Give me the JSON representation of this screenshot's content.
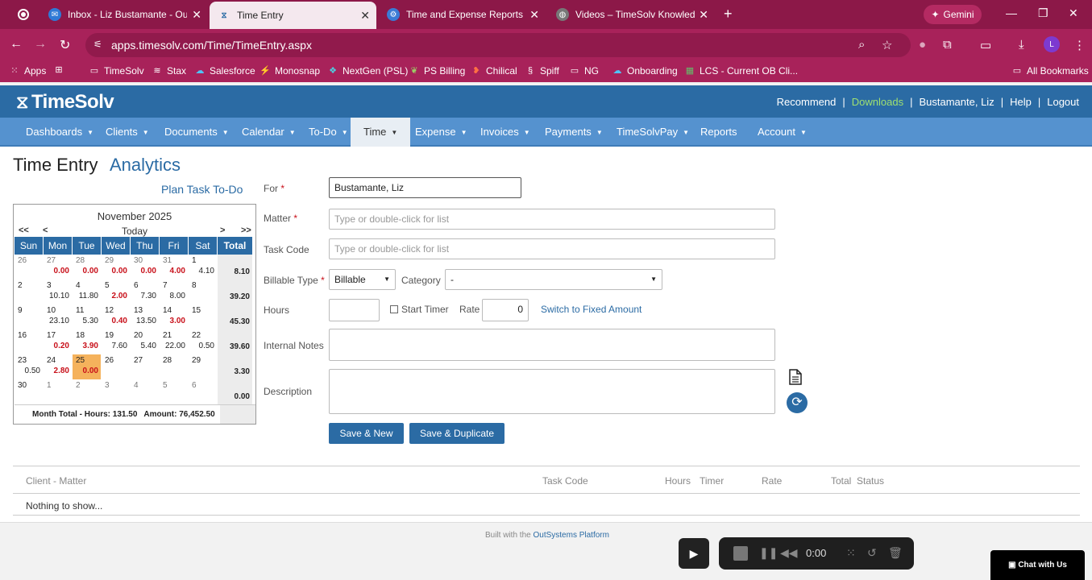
{
  "browser": {
    "tabs": [
      {
        "title": "Inbox - Liz Bustamante - Outlo"
      },
      {
        "title": "Time Entry"
      },
      {
        "title": "Time and Expense Reports"
      },
      {
        "title": "Videos – TimeSolv Knowledge B"
      }
    ],
    "gemini_label": "Gemini",
    "url": "apps.timesolv.com/Time/TimeEntry.aspx",
    "profile_initial": "L",
    "bookmarks": [
      "Apps",
      "TimeSolv",
      "Stax",
      "Salesforce",
      "Monosnap",
      "NextGen (PSL)",
      "PS Billing",
      "Chilical",
      "Spiff",
      "NG",
      "Onboarding",
      "LCS - Current OB Cli..."
    ],
    "all_bookmarks": "All Bookmarks"
  },
  "app": {
    "logo": "TimeSolv",
    "top_links": {
      "recommend": "Recommend",
      "downloads": "Downloads",
      "user": "Bustamante, Liz",
      "help": "Help",
      "logout": "Logout"
    },
    "nav": [
      "Dashboards",
      "Clients",
      "Documents",
      "Calendar",
      "To-Do",
      "Time",
      "Expense",
      "Invoices",
      "Payments",
      "TimeSolvPay",
      "Reports",
      "Account"
    ],
    "active_nav": "Time",
    "colors": {
      "header": "#2b6ba4",
      "nav": "#5592cf",
      "accent": "#2b6ba4",
      "today": "#f5b25c",
      "negative": "#c8101a"
    }
  },
  "page": {
    "title": "Time Entry",
    "analytics_tab": "Analytics",
    "plan_todo": "Plan Task To-Do"
  },
  "calendar": {
    "month": "November 2025",
    "nav_prev_year": "<<",
    "nav_prev": "<",
    "today": "Today",
    "nav_next": ">",
    "nav_next_year": ">>",
    "headers": [
      "Sun",
      "Mon",
      "Tue",
      "Wed",
      "Thu",
      "Fri",
      "Sat",
      "Total"
    ],
    "weeks": [
      {
        "days": [
          [
            "26",
            "",
            ""
          ],
          [
            "27",
            "0.00",
            "r"
          ],
          [
            "28",
            "0.00",
            "r"
          ],
          [
            "29",
            "0.00",
            "r"
          ],
          [
            "30",
            "0.00",
            "r"
          ],
          [
            "31",
            "4.00",
            "r"
          ],
          [
            "1",
            "4.10",
            "b"
          ]
        ],
        "total": "8.10"
      },
      {
        "days": [
          [
            "2",
            "",
            ""
          ],
          [
            "3",
            "10.10",
            "b"
          ],
          [
            "4",
            "11.80",
            "b"
          ],
          [
            "5",
            "2.00",
            "r"
          ],
          [
            "6",
            "7.30",
            "b"
          ],
          [
            "7",
            "8.00",
            "b"
          ],
          [
            "8",
            "",
            ""
          ]
        ],
        "total": "39.20"
      },
      {
        "days": [
          [
            "9",
            "",
            ""
          ],
          [
            "10",
            "23.10",
            "b"
          ],
          [
            "11",
            "5.30",
            "b"
          ],
          [
            "12",
            "0.40",
            "r"
          ],
          [
            "13",
            "13.50",
            "b"
          ],
          [
            "14",
            "3.00",
            "r"
          ],
          [
            "15",
            "",
            ""
          ]
        ],
        "total": "45.30"
      },
      {
        "days": [
          [
            "16",
            "",
            ""
          ],
          [
            "17",
            "0.20",
            "r"
          ],
          [
            "18",
            "3.90",
            "r"
          ],
          [
            "19",
            "7.60",
            "b"
          ],
          [
            "20",
            "5.40",
            "b"
          ],
          [
            "21",
            "22.00",
            "b"
          ],
          [
            "22",
            "0.50",
            "b"
          ]
        ],
        "total": "39.60"
      },
      {
        "days": [
          [
            "23",
            "0.50",
            "b"
          ],
          [
            "24",
            "2.80",
            "r"
          ],
          [
            "25",
            "0.00",
            "r"
          ],
          [
            "26",
            "",
            ""
          ],
          [
            "27",
            "",
            ""
          ],
          [
            "28",
            "",
            ""
          ],
          [
            "29",
            "",
            ""
          ]
        ],
        "total": "3.30"
      },
      {
        "days": [
          [
            "30",
            "",
            ""
          ],
          [
            "1",
            "",
            ""
          ],
          [
            "2",
            "",
            ""
          ],
          [
            "3",
            "",
            ""
          ],
          [
            "4",
            "",
            ""
          ],
          [
            "5",
            "",
            ""
          ],
          [
            "6",
            "",
            ""
          ]
        ],
        "total": "0.00"
      }
    ],
    "month_total": "Month Total - Hours: 131.50   Amount: 76,452.50"
  },
  "form": {
    "for_label": "For",
    "for_value": "Bustamante, Liz",
    "matter_label": "Matter",
    "matter_placeholder": "Type or double-click for list",
    "task_label": "Task Code",
    "task_placeholder": "Type or double-click for list",
    "billable_label": "Billable Type",
    "billable_value": "Billable",
    "category_label": "Category",
    "category_value": "-",
    "hours_label": "Hours",
    "hours_value": "",
    "start_timer": "Start Timer",
    "rate_label": "Rate",
    "rate_value": "0",
    "fixed_link": "Switch to Fixed Amount",
    "notes_label": "Internal Notes",
    "desc_label": "Description",
    "save_new": "Save & New",
    "save_dup": "Save & Duplicate"
  },
  "table": {
    "columns": [
      "Client - Matter",
      "Task Code",
      "Hours",
      "Timer",
      "Rate",
      "Total",
      "Status"
    ],
    "empty": "Nothing to show..."
  },
  "footer": {
    "built_prefix": "Built with the",
    "platform": "OutSystems Platform"
  },
  "recorder": {
    "time": "0:00"
  },
  "chat": "Chat with Us"
}
